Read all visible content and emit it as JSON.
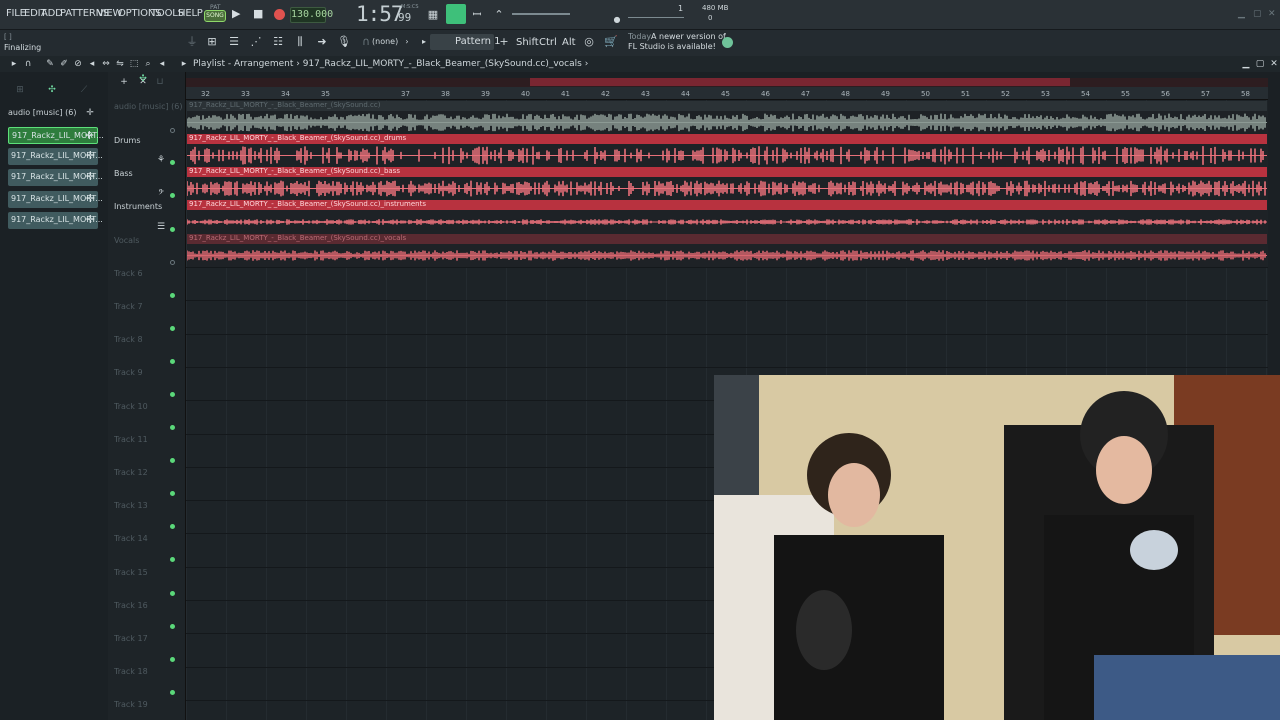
{
  "menu": [
    "FILE",
    "EDIT",
    "ADD",
    "PATTERNS",
    "VIEW",
    "OPTIONS",
    "TOOLS",
    "HELP"
  ],
  "transport": {
    "mode_top": "PAT",
    "mode_label": "SONG",
    "tempo": "130.000",
    "time": "1:57",
    "time_ms": "99",
    "time_unit": "M:S:CS"
  },
  "cpu": {
    "value": "1",
    "memory": "480 MB",
    "poly": "0"
  },
  "hint": {
    "top": "[ ]",
    "text": "Finalizing"
  },
  "toolbar2": {
    "snap": "(none)",
    "pattern": "Pattern 1",
    "keys": [
      "Shift",
      "Ctrl",
      "Alt"
    ],
    "news_today": "Today",
    "news_line1": "A newer version of",
    "news_line2": "FL Studio is available!"
  },
  "playlist": {
    "title": "Playlist - Arrangement",
    "breadcrumb": "917_Rackz_LIL_MORTY_-_Black_Beamer_(SkySound.cc)_vocals",
    "arrow": "›"
  },
  "picker": {
    "folder": "audio [music] (6)",
    "items": [
      "917_Rackz_LIL_MORT...",
      "917_Rackz_LIL_MORT...",
      "917_Rackz_LIL_MORT...",
      "917_Rackz_LIL_MORT...",
      "917_Rackz_LIL_MORT..."
    ]
  },
  "ruler": [
    "32",
    "33",
    "34",
    "35",
    "37",
    "38",
    "39",
    "40",
    "41",
    "42",
    "43",
    "44",
    "45",
    "46",
    "47",
    "48",
    "49",
    "50",
    "51",
    "52",
    "53",
    "54",
    "55",
    "56",
    "57",
    "58"
  ],
  "tracks": [
    {
      "name": "Drums"
    },
    {
      "name": "Bass"
    },
    {
      "name": "Instruments"
    },
    {
      "name": "Vocals"
    },
    {
      "name": "Track 6"
    },
    {
      "name": "Track 7"
    },
    {
      "name": "Track 8"
    },
    {
      "name": "Track 9"
    },
    {
      "name": "Track 10"
    },
    {
      "name": "Track 11"
    },
    {
      "name": "Track 12"
    },
    {
      "name": "Track 13"
    },
    {
      "name": "Track 14"
    },
    {
      "name": "Track 15"
    },
    {
      "name": "Track 16"
    },
    {
      "name": "Track 17"
    },
    {
      "name": "Track 18"
    },
    {
      "name": "Track 19"
    }
  ],
  "track0_label": "audio [music] (6)",
  "clips": [
    {
      "label": "917_Rackz_LIL_MORTY_-_Black_Beamer_(SkySound.cc)"
    },
    {
      "label": "917_Rackz_LIL_MORTY_-_Black_Beamer_(SkySound.cc)_drums"
    },
    {
      "label": "917_Rackz_LIL_MORTY_-_Black_Beamer_(SkySound.cc)_bass"
    },
    {
      "label": "917_Rackz_LIL_MORTY_-_Black_Beamer_(SkySound.cc)_instruments"
    },
    {
      "label": "917_Rackz_LIL_MORTY_-_Black_Beamer_(SkySound.cc)_vocals"
    }
  ],
  "colors": {
    "accent": "#3ec07a",
    "clip": "#b8323f",
    "wave": "#e8707a",
    "bg": "#1b2024"
  }
}
